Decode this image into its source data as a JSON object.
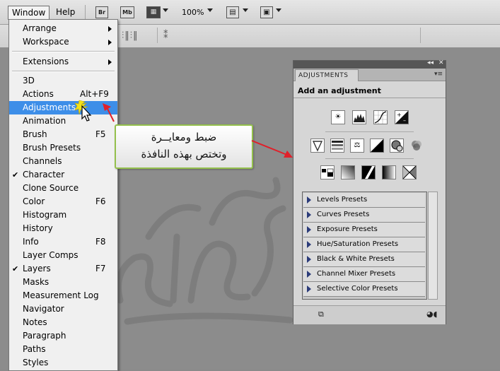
{
  "menubar": {
    "window_label": "Window",
    "help_label": "Help",
    "br_label": "Br",
    "mb_label": "Mb",
    "zoom": "100%"
  },
  "window_menu": {
    "items": [
      {
        "label": "Arrange",
        "submenu": true
      },
      {
        "label": "Workspace",
        "submenu": true
      },
      {
        "label": "Extensions",
        "submenu": true
      },
      {
        "label": "3D"
      },
      {
        "label": "Actions",
        "shortcut": "Alt+F9"
      },
      {
        "label": "Adjustments",
        "highlighted": true
      },
      {
        "label": "Animation"
      },
      {
        "label": "Brush",
        "shortcut": "F5"
      },
      {
        "label": "Brush Presets"
      },
      {
        "label": "Channels"
      },
      {
        "label": "Character",
        "checked": true
      },
      {
        "label": "Clone Source"
      },
      {
        "label": "Color",
        "shortcut": "F6"
      },
      {
        "label": "Histogram"
      },
      {
        "label": "History"
      },
      {
        "label": "Info",
        "shortcut": "F8"
      },
      {
        "label": "Layer Comps"
      },
      {
        "label": "Layers",
        "shortcut": "F7",
        "checked": true
      },
      {
        "label": "Masks"
      },
      {
        "label": "Measurement Log"
      },
      {
        "label": "Navigator"
      },
      {
        "label": "Notes"
      },
      {
        "label": "Paragraph"
      },
      {
        "label": "Paths"
      },
      {
        "label": "Styles"
      }
    ],
    "check_mark": "✔"
  },
  "callout": {
    "line1": "ضبط ومعايــرة",
    "line2": "وتختص بهذه النافذة",
    "border_color": "#94c04c"
  },
  "panel": {
    "tab_label": "ADJUSTMENTS",
    "title": "Add an adjustment",
    "presets": [
      "Levels Presets",
      "Curves Presets",
      "Exposure Presets",
      "Hue/Saturation Presets",
      "Black & White Presets",
      "Channel Mixer Presets",
      "Selective Color Presets"
    ]
  },
  "colors": {
    "highlight": "#3d8ee8",
    "arrow": "#e0202a"
  }
}
